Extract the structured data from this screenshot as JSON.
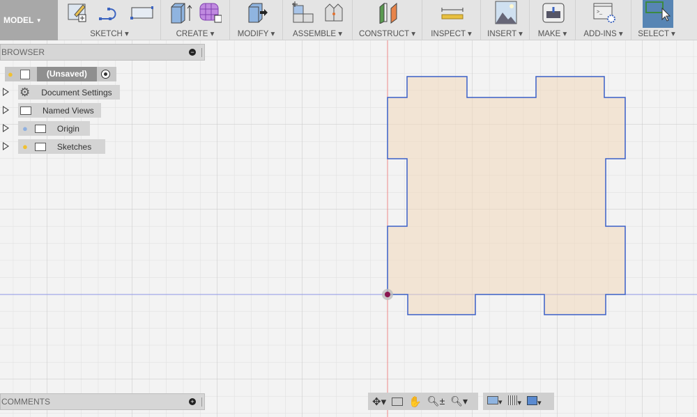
{
  "toolbar": {
    "workspace": "MODEL",
    "groups": [
      {
        "label": "SKETCH",
        "icons": [
          "create-sketch-icon",
          "spline-icon",
          "rectangle-icon"
        ]
      },
      {
        "label": "CREATE",
        "icons": [
          "extrude-icon",
          "form-icon"
        ]
      },
      {
        "label": "MODIFY",
        "icons": [
          "press-pull-icon"
        ]
      },
      {
        "label": "ASSEMBLE",
        "icons": [
          "new-component-icon",
          "joint-icon"
        ]
      },
      {
        "label": "CONSTRUCT",
        "icons": [
          "offset-plane-icon"
        ]
      },
      {
        "label": "INSPECT",
        "icons": [
          "measure-icon"
        ]
      },
      {
        "label": "INSERT",
        "icons": [
          "insert-image-icon"
        ]
      },
      {
        "label": "MAKE",
        "icons": [
          "3d-print-icon"
        ]
      },
      {
        "label": "ADD-INS",
        "icons": [
          "scripts-icon"
        ]
      },
      {
        "label": "SELECT",
        "icons": [
          "select-icon"
        ]
      }
    ]
  },
  "browser": {
    "title": "BROWSER",
    "root": "(Unsaved)",
    "items": [
      {
        "label": "Document Settings",
        "icon": "gear-icon"
      },
      {
        "label": "Named Views",
        "icon": "folder-icon"
      },
      {
        "label": "Origin",
        "icon": "folder-icon",
        "visibility": "off"
      },
      {
        "label": "Sketches",
        "icon": "folder-icon",
        "visibility": "on"
      }
    ]
  },
  "comments": {
    "title": "COMMENTS"
  },
  "colors": {
    "sketch_line": "#3a5fc8",
    "profile_fill": "#f2e6d8",
    "x_axis": "#e85a5a",
    "y_axis": "#6d7de0",
    "select_active": "#5785b4"
  }
}
